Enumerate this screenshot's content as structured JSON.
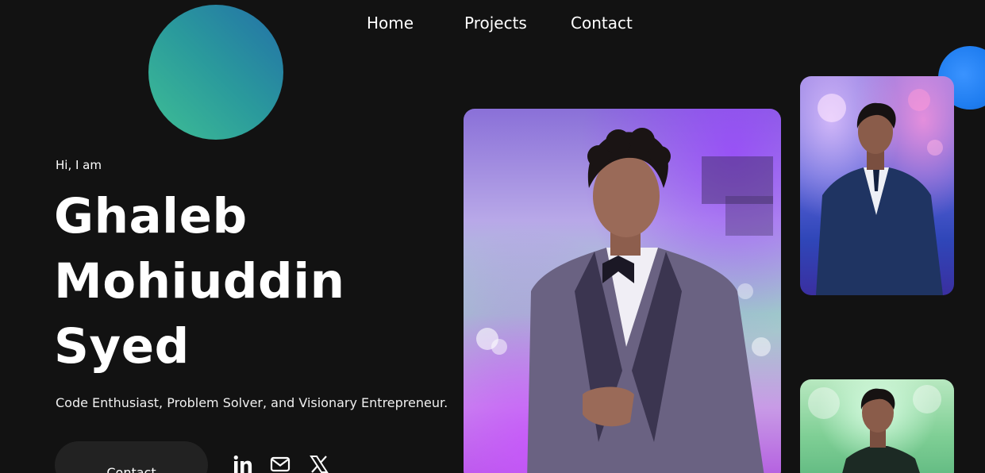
{
  "nav": {
    "items": [
      {
        "label": "Home"
      },
      {
        "label": "Projects"
      },
      {
        "label": "Contact"
      }
    ]
  },
  "hero": {
    "greeting": "Hi, I am",
    "name_lines": [
      "Ghaleb",
      "Mohiuddin",
      "Syed"
    ],
    "tagline": "Code Enthusiast, Problem Solver, and Visionary Entrepreneur.",
    "contact_button": "Contact"
  },
  "social": {
    "icons": [
      "linkedin-icon",
      "mail-icon",
      "x-icon"
    ]
  },
  "colors": {
    "background": "#121212",
    "text": "#ffffff",
    "button_bg": "#222222",
    "blob_gradient_start": "#3fbf94",
    "blob_gradient_end": "#2370a8",
    "accent_blue": "#1f7df0"
  }
}
